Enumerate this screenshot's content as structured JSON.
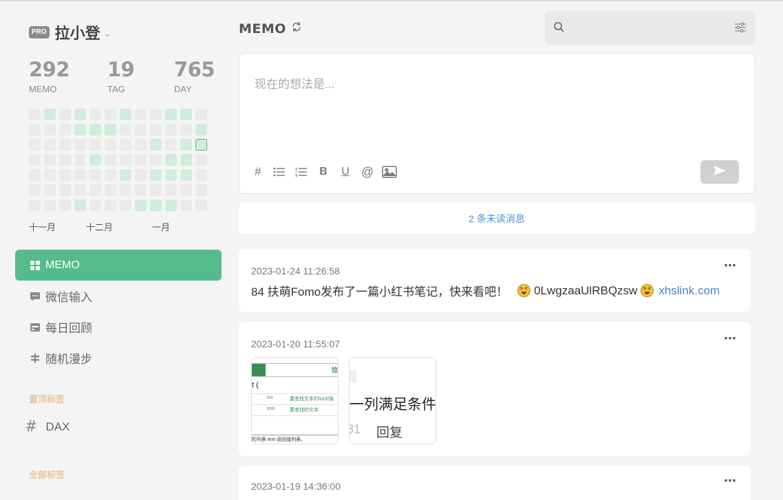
{
  "user": {
    "badge": "PRO",
    "name": "拉小登"
  },
  "stats": [
    {
      "value": "292",
      "label": "MEMO"
    },
    {
      "value": "19",
      "label": "TAG"
    },
    {
      "value": "765",
      "label": "DAY"
    }
  ],
  "heatmap": {
    "months": [
      "十一月",
      "十二月",
      "一月"
    ],
    "active_cells": [
      [
        0,
        1
      ],
      [
        0,
        3
      ],
      [
        0,
        6
      ],
      [
        0,
        9
      ],
      [
        0,
        10
      ],
      [
        1,
        3
      ],
      [
        1,
        4
      ],
      [
        1,
        5
      ],
      [
        1,
        11
      ],
      [
        2,
        8
      ],
      [
        2,
        10
      ],
      [
        3,
        4
      ],
      [
        3,
        9
      ],
      [
        3,
        10
      ],
      [
        4,
        6
      ],
      [
        4,
        8
      ],
      [
        4,
        9
      ],
      [
        4,
        10
      ],
      [
        6,
        3
      ],
      [
        6,
        7
      ],
      [
        6,
        8
      ],
      [
        6,
        9
      ]
    ],
    "today_cell": [
      2,
      11
    ]
  },
  "nav": [
    {
      "label": "MEMO",
      "icon": "grid-icon",
      "active": true
    },
    {
      "label": "微信输入",
      "icon": "wechat-icon",
      "active": false
    },
    {
      "label": "每日回顾",
      "icon": "calendar-icon",
      "active": false
    },
    {
      "label": "随机漫步",
      "icon": "shuffle-icon",
      "active": false
    }
  ],
  "pinned_section": {
    "title": "置顶标签",
    "tags": [
      "DAX"
    ]
  },
  "all_tags_section": {
    "title": "全部标签"
  },
  "header": {
    "title": "MEMO"
  },
  "search": {
    "placeholder": ""
  },
  "editor": {
    "placeholder": "现在的想法是..."
  },
  "toolbar": {
    "hash": "#",
    "bold": "B",
    "underline": "U",
    "mention": "@"
  },
  "unread": "2 条未读消息",
  "memos": [
    {
      "date": "2023-01-24 11:26:58",
      "text_prefix": "84 扶萌Fomo发布了一篇小红书笔记，快来看吧！",
      "code": "0LwgzaaUlRBQzsw",
      "link": "xhslink.com"
    },
    {
      "date": "2023-01-20 11:55:07",
      "images": [
        {
          "label": "拉",
          "rows": [
            "t (",
            "list",
            "要查找文本的list对象",
            "text",
            "要查找的文本"
          ],
          "footer": "的列表 text 返回值列表。"
        },
        {
          "line1": "一列满足条件",
          "line2_num": "31",
          "line2_text": "回复"
        }
      ]
    },
    {
      "date": "2023-01-19 14:36:00"
    }
  ],
  "more_icon": "⋯",
  "colors": {
    "accent": "#55bb8a",
    "link": "#4a80d9",
    "tag_section": "#e6c89e"
  }
}
